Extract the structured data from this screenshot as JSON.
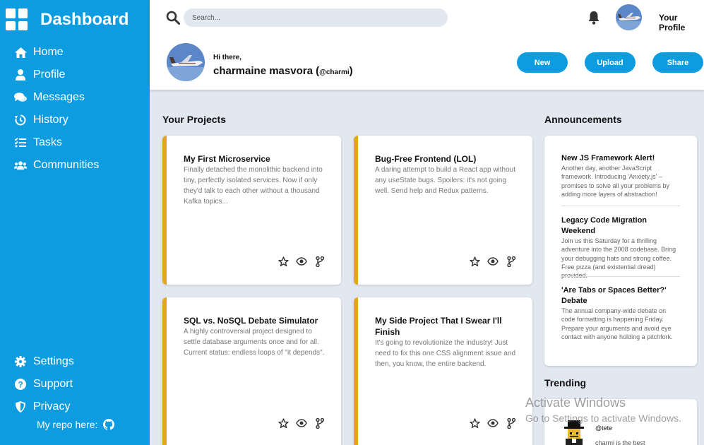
{
  "sidebar": {
    "brand": "Dashboard",
    "items": [
      {
        "label": "Home",
        "icon": "home-icon"
      },
      {
        "label": "Profile",
        "icon": "user-icon"
      },
      {
        "label": "Messages",
        "icon": "comments-icon"
      },
      {
        "label": "History",
        "icon": "history-icon"
      },
      {
        "label": "Tasks",
        "icon": "tasks-icon"
      },
      {
        "label": "Communities",
        "icon": "users-icon"
      }
    ],
    "bottom_items": [
      {
        "label": "Settings",
        "icon": "gear-icon"
      },
      {
        "label": "Support",
        "icon": "question-icon"
      },
      {
        "label": "Privacy",
        "icon": "shield-icon"
      }
    ],
    "repo_label": "My repo here:"
  },
  "header": {
    "search_placeholder": "Search...",
    "profile_label": "Your Profile",
    "greeting": "Hi there,",
    "user_name": "charmaine masvora",
    "user_handle": "@charmi",
    "buttons": {
      "new": "New",
      "upload": "Upload",
      "share": "Share"
    }
  },
  "projects": {
    "title": "Your Projects",
    "items": [
      {
        "title": "My First Microservice",
        "desc": "Finally detached the monolithic backend into tiny, perfectly isolated services. Now if only they'd talk to each other without a thousand Kafka topics..."
      },
      {
        "title": "Bug-Free Frontend (LOL)",
        "desc": "A daring attempt to build a React app without any useState bugs. Spoilers: it's not going well. Send help and Redux patterns."
      },
      {
        "title": "SQL vs. NoSQL Debate Simulator",
        "desc": "A highly controversial project designed to settle database arguments once and for all. Current status: endless loops of \"it depends\"."
      },
      {
        "title": "My Side Project That I Swear I'll Finish",
        "desc": "It's going to revolutionize the industry! Just need to fix this one CSS alignment issue and then, you know, the entire backend."
      }
    ]
  },
  "announcements": {
    "title": "Announcements",
    "items": [
      {
        "title": "New JS Framework Alert!",
        "desc": "Another day, another JavaScript framework. Introducing 'Anxiety.js' – promises to solve all your problems by adding more layers of abstraction!"
      },
      {
        "title": "Legacy Code Migration Weekend",
        "desc": "Join us this Saturday for a thrilling adventure into the 2008 codebase. Bring your debugging hats and strong coffee. Free pizza (and existential dread) provided."
      },
      {
        "title": "'Are Tabs or Spaces Better?' Debate",
        "desc": "The annual company-wide debate on code formatting is happening Friday. Prepare your arguments and avoid eye contact with anyone holding a pitchfork."
      }
    ]
  },
  "trending": {
    "title": "Trending",
    "handle": "@tete",
    "text": "charmi is the best"
  },
  "watermark": {
    "line1": "Activate Windows",
    "line2": "Go to Settings to activate Windows."
  },
  "colors": {
    "primary": "#0e9ce0",
    "accent": "#e6a520",
    "background": "#e2e8f0"
  }
}
